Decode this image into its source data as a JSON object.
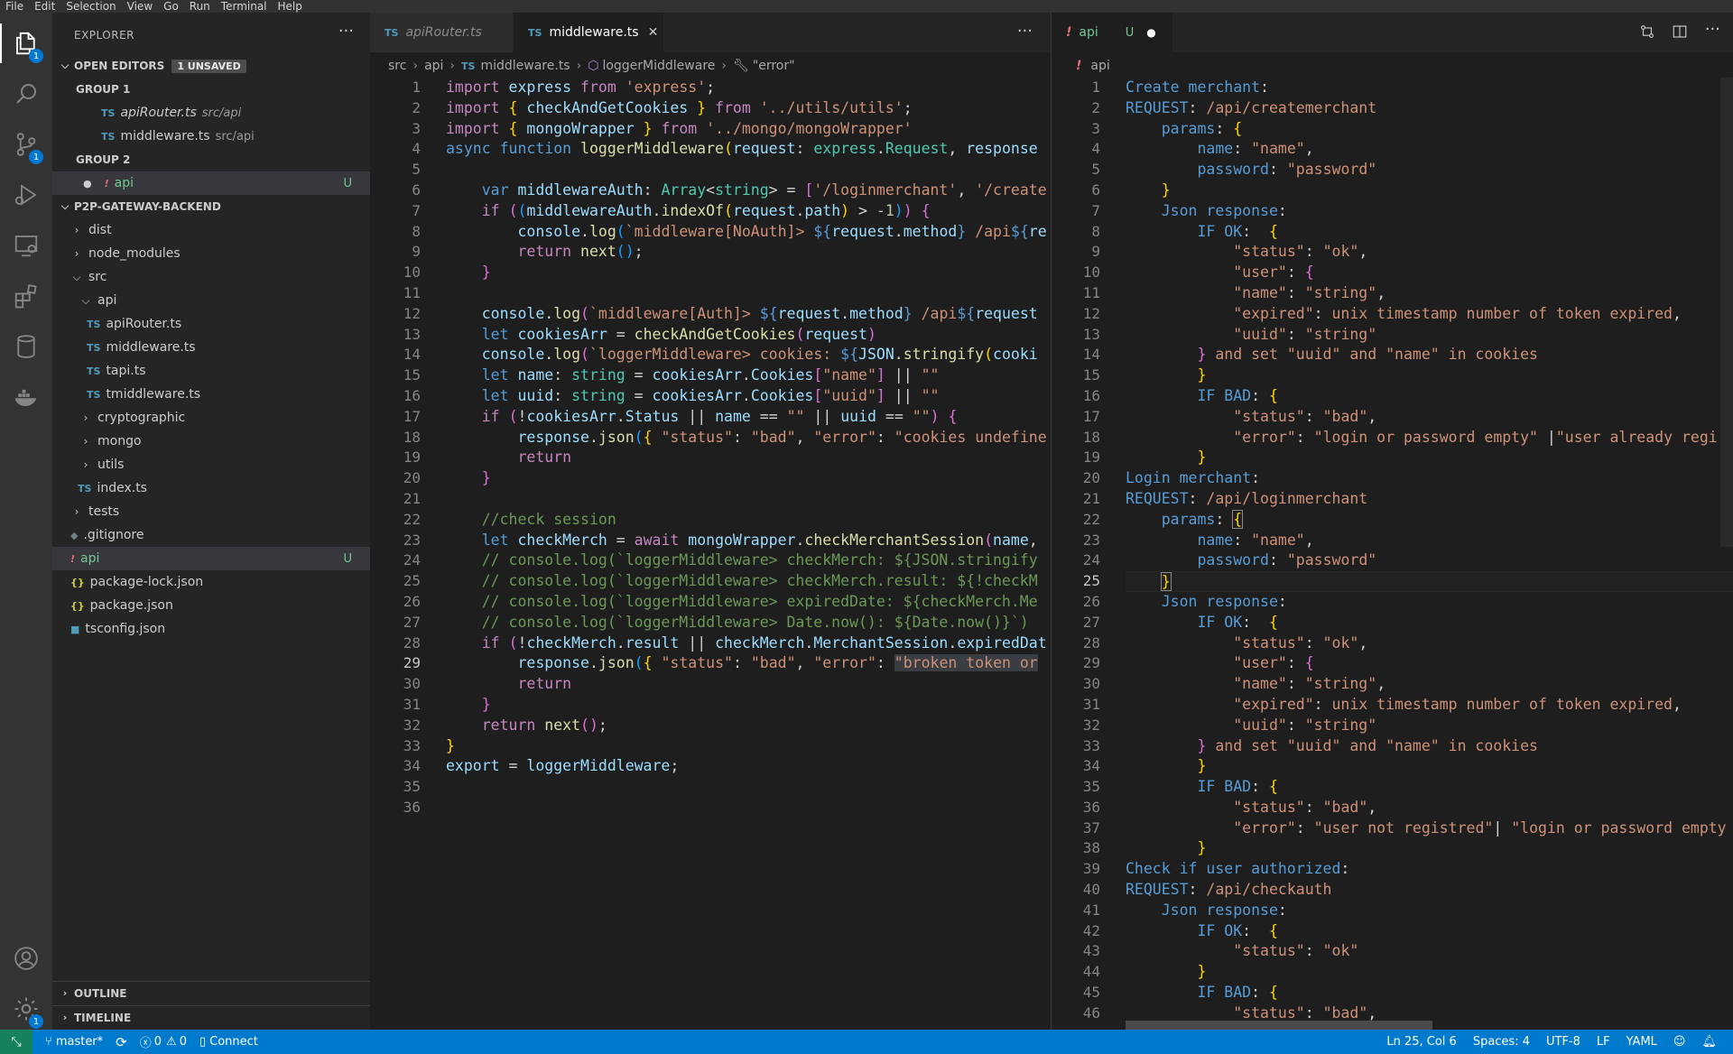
{
  "menu": [
    "File",
    "Edit",
    "Selection",
    "View",
    "Go",
    "Run",
    "Terminal",
    "Help"
  ],
  "activity_bar": {
    "explorer_badge": "1",
    "scm_badge": "1",
    "settings_badge": "1"
  },
  "sidebar": {
    "title": "EXPLORER",
    "open_editors": {
      "label": "OPEN EDITORS",
      "unsaved": "1 UNSAVED",
      "group1_label": "GROUP 1",
      "group2_label": "GROUP 2",
      "group1_files": [
        {
          "name": "apiRouter.ts",
          "path": "src/api"
        },
        {
          "name": "middleware.ts",
          "path": "src/api"
        }
      ],
      "group2_file": {
        "name": "api",
        "status": "U"
      }
    },
    "project": {
      "label": "P2P-GATEWAY-BACKEND",
      "items": [
        {
          "name": "dist"
        },
        {
          "name": "node_modules"
        },
        {
          "name": "src"
        },
        {
          "name": "api"
        },
        {
          "name": "apiRouter.ts"
        },
        {
          "name": "middleware.ts"
        },
        {
          "name": "tapi.ts"
        },
        {
          "name": "tmiddleware.ts"
        },
        {
          "name": "cryptographic"
        },
        {
          "name": "mongo"
        },
        {
          "name": "utils"
        },
        {
          "name": "index.ts"
        },
        {
          "name": "tests"
        },
        {
          "name": ".gitignore"
        },
        {
          "name": "api",
          "status": "U"
        },
        {
          "name": "package-lock.json"
        },
        {
          "name": "package.json"
        },
        {
          "name": "tsconfig.json"
        }
      ]
    },
    "outline_label": "OUTLINE",
    "timeline_label": "TIMELINE"
  },
  "editor_left": {
    "tabs": [
      {
        "label": "apiRouter.ts",
        "icon": "TS"
      },
      {
        "label": "middleware.ts",
        "icon": "TS"
      }
    ],
    "breadcrumb": [
      "src",
      "api",
      "middleware.ts",
      "loggerMiddleware",
      "\"error\""
    ],
    "current_line": "29"
  },
  "editor_right": {
    "tab": {
      "label": "api",
      "status": "U"
    },
    "breadcrumb": [
      "api"
    ],
    "current_line": "25"
  },
  "status_bar": {
    "branch": "master*",
    "errors": "0",
    "warnings": "0",
    "connect": "Connect",
    "position": "Ln 25, Col 6",
    "spaces": "Spaces: 4",
    "encoding": "UTF-8",
    "eol": "LF",
    "language": "YAML"
  },
  "colors": {
    "accent": "#007acc",
    "badge": "#0078d4",
    "untracked": "#73c991"
  }
}
